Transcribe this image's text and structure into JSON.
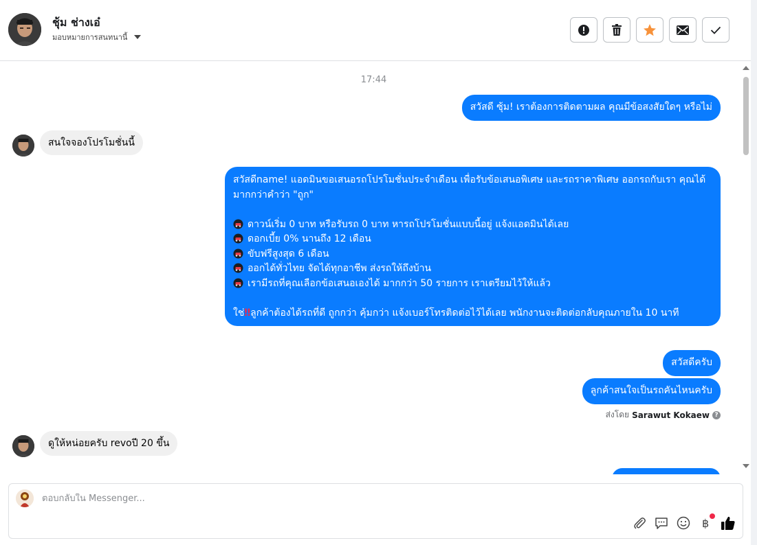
{
  "header": {
    "contact_name": "ชุ้ม ช่างเอ๋",
    "assign_label": "มอบหมายการสนทนานี้",
    "actions": [
      {
        "name": "mark-spam",
        "icon": "exclamation-circle-icon"
      },
      {
        "name": "delete",
        "icon": "trash-icon"
      },
      {
        "name": "star",
        "icon": "star-icon"
      },
      {
        "name": "mark-unread",
        "icon": "envelope-icon"
      },
      {
        "name": "mark-done",
        "icon": "checkmark-icon"
      }
    ],
    "star_color": "#f7923b"
  },
  "chat": {
    "timestamp": "17:44",
    "messages": [
      {
        "direction": "out",
        "text": "สวัสดี ซุ้ม! เราต้องการติดตามผล คุณมีข้อสงสัยใดๆ หรือไม่"
      },
      {
        "direction": "in",
        "text": "สนใจจองโปรโมชั่นนี้"
      },
      {
        "direction": "out",
        "intro": "สวัสดีname! แอดมินขอเสนอรถโปรโมชั่นประจำเดือน เพื่อรับข้อเสนอพิเศษ และรถราคาพิเศษ ออกรถกับเรา คุณได้มากกว่าคำว่า \"ถูก\"",
        "bullets": [
          "ดาวน์เริ่ม 0 บาท หรือรับรถ 0 บาท หารถโปรโมชั่นแบบนี้อยู่ แจ้งแอดมินได้เลย",
          "ดอกเบี้ย 0% นานถึง 12 เดือน",
          "ขับฟรีสูงสุด 6 เดือน",
          "ออกได้ทั่วไทย จัดได้ทุกอาชีพ ส่งรถให้ถึงบ้าน",
          "เรามีรถที่คุณเลือกข้อเสนอเองได้ มากกว่า 50 รายการ เราเตรียมไว้ให้แล้ว"
        ],
        "closing_prefix": "ใช่",
        "closing": "ลูกค้าต้องได้รถที่ดี ถูกกว่า คุ้มกว่า แจ้งเบอร์โทรติดต่อไว้ได้เลย พนักงานจะติดต่อกลับคุณภายใน 10 นาที"
      },
      {
        "direction": "out",
        "text": "สวัสดีครับ"
      },
      {
        "direction": "out",
        "text": "ลูกค้าสนใจเป็นรถคันไหนครับ"
      },
      {
        "direction": "in",
        "text": "ดูให้หน่อยครับ revoปี 20 ขึ้น"
      }
    ],
    "sent_by_prefix": "ส่งโดย",
    "sent_by_name": "Sarawut Kokaew",
    "bubble_color": "#0a7cff"
  },
  "composer": {
    "placeholder": "ตอบกลับใน Messenger...",
    "tools": [
      "paperclip-icon",
      "saved-reply-icon",
      "emoji-icon",
      "baht-payment-icon",
      "like-thumb-icon"
    ],
    "like_color": "#050505"
  }
}
